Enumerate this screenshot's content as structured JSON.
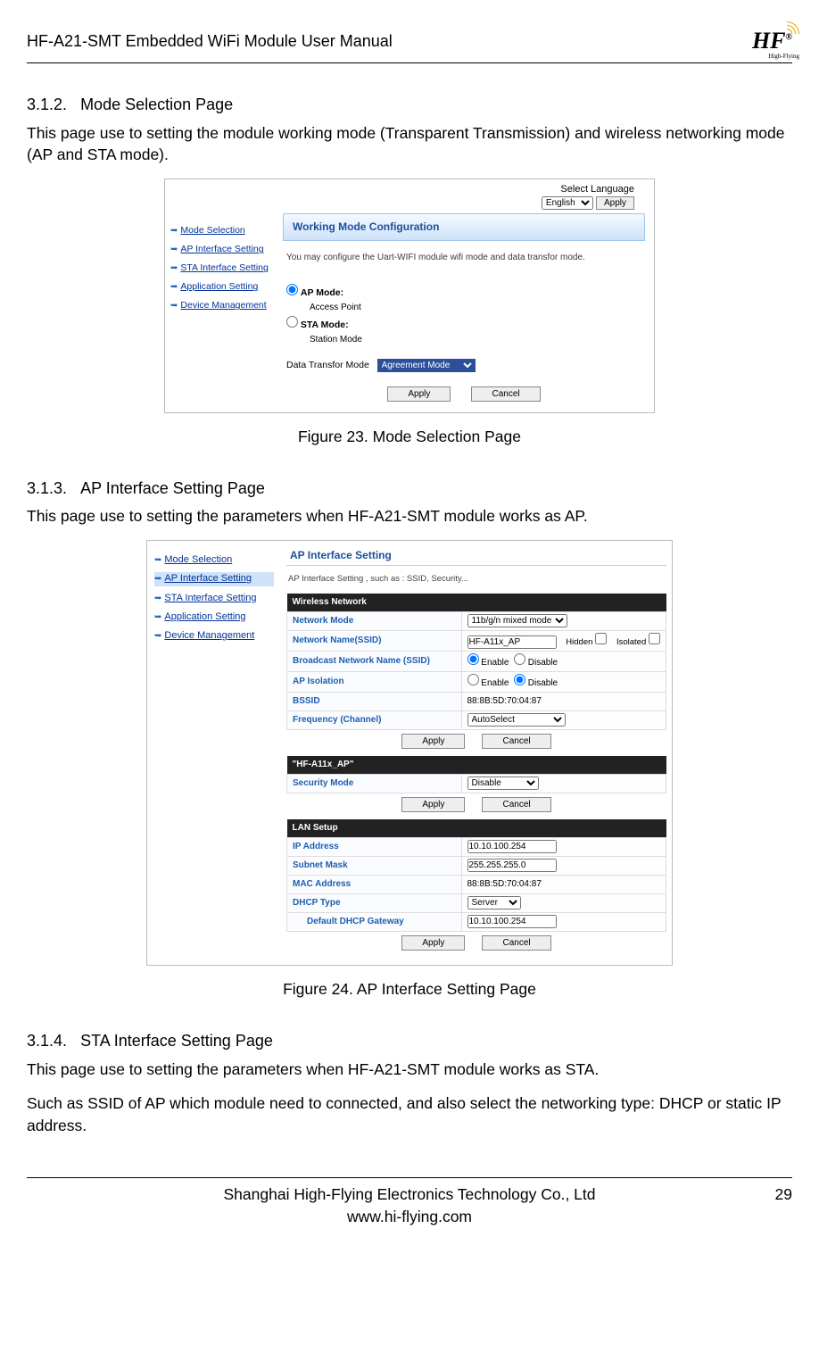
{
  "header": {
    "doc_title": "HF-A21-SMT  Embedded WiFi Module User Manual",
    "logo_text": "HF",
    "logo_reg": "®",
    "logo_sub": "High-Flying"
  },
  "s312": {
    "num": "3.1.2.",
    "title": "Mode Selection Page",
    "desc": "This page use to setting the module working mode (Transparent Transmission) and wireless networking mode (AP and STA mode).",
    "caption": "Figure 23.    Mode Selection Page"
  },
  "shot1": {
    "lang_label": "Select Language",
    "lang_option": "English",
    "apply": "Apply",
    "nav": [
      "Mode Selection",
      "AP Interface Setting",
      "STA Interface Setting",
      "Application Setting",
      "Device Management"
    ],
    "pane_title": "Working Mode Configuration",
    "pane_sub": "You may configure the Uart-WIFI module wifi mode and data transfor mode.",
    "ap_mode": "AP Mode:",
    "ap_sub": "Access Point",
    "sta_mode": "STA Mode:",
    "sta_sub": "Station Mode",
    "dt_label": "Data Transfor Mode",
    "dt_value": "Agreement Mode",
    "btn_apply": "Apply",
    "btn_cancel": "Cancel"
  },
  "s313": {
    "num": "3.1.3.",
    "title": "AP Interface Setting Page",
    "desc": "This page use to setting the parameters when HF-A21-SMT module works as AP.",
    "caption": "Figure 24.    AP Interface Setting Page"
  },
  "shot2": {
    "nav": [
      "Mode Selection",
      "AP Interface Setting",
      "STA Interface Setting",
      "Application Setting",
      "Device Management"
    ],
    "pane_title": "AP Interface Setting",
    "pane_sub": "AP Interface Setting , such as : SSID, Security...",
    "wireless_hdr": "Wireless Network",
    "rows1": {
      "network_mode": "Network Mode",
      "network_mode_v": "11b/g/n mixed mode",
      "ssid": "Network Name(SSID)",
      "ssid_v": "HF-A11x_AP",
      "hidden": "Hidden",
      "isolated": "Isolated",
      "bcast": "Broadcast Network Name (SSID)",
      "enable": "Enable",
      "disable": "Disable",
      "apiso": "AP Isolation",
      "bssid": "BSSID",
      "bssid_v": "88:8B:5D:70:04:87",
      "freq": "Frequency (Channel)",
      "freq_v": "AutoSelect"
    },
    "sec_hdr": "\"HF-A11x_AP\"",
    "sec_mode": "Security Mode",
    "sec_mode_v": "Disable",
    "lan_hdr": "LAN Setup",
    "rows3": {
      "ip": "IP Address",
      "ip_v": "10.10.100.254",
      "mask": "Subnet Mask",
      "mask_v": "255.255.255.0",
      "mac": "MAC Address",
      "mac_v": "88:8B:5D:70:04:87",
      "dhcp": "DHCP Type",
      "dhcp_v": "Server",
      "gw": "Default DHCP Gateway",
      "gw_v": "10.10.100.254"
    },
    "btn_apply": "Apply",
    "btn_cancel": "Cancel"
  },
  "s314": {
    "num": "3.1.4.",
    "title": "STA Interface Setting Page",
    "desc1": "This page use to setting the parameters when HF-A21-SMT module works as STA.",
    "desc2": "Such as SSID of AP which module need to connected, and also select the networking type: DHCP or static IP address."
  },
  "footer": {
    "company": "Shanghai High-Flying Electronics Technology Co., Ltd",
    "url": "www.hi-flying.com",
    "page": "29"
  }
}
